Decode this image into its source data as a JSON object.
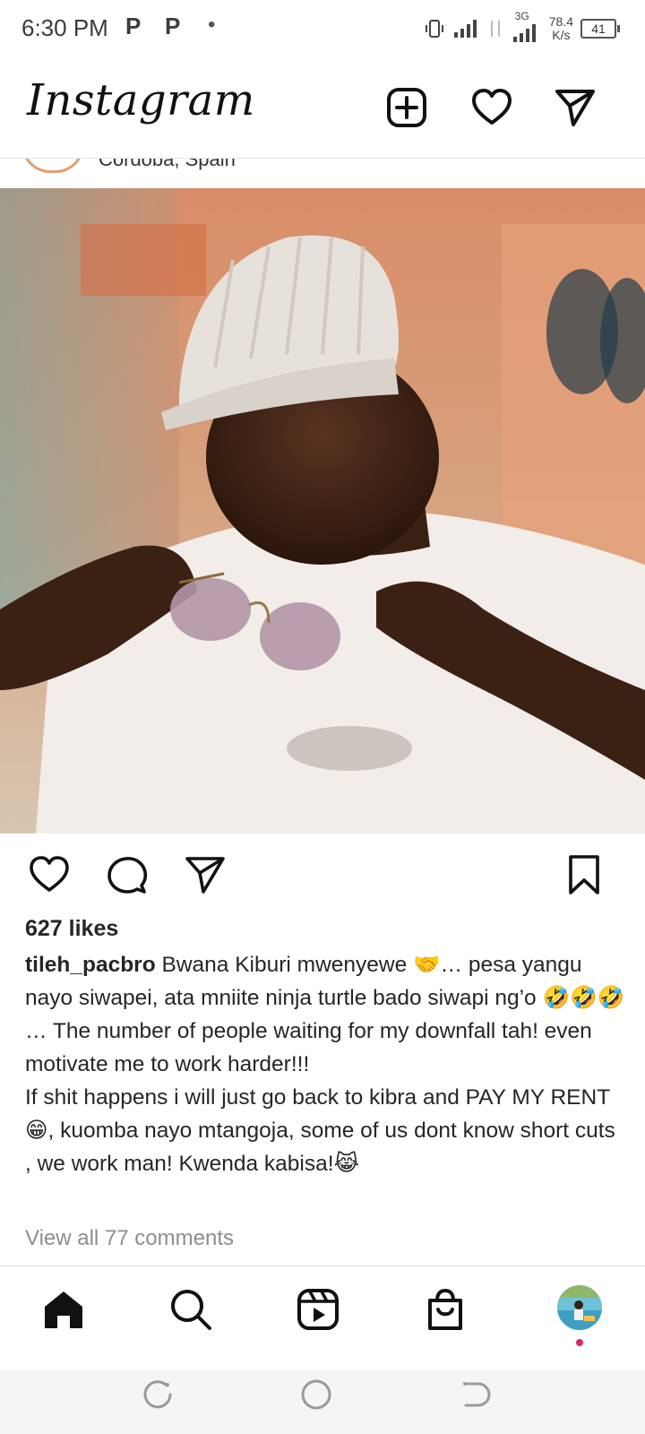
{
  "status_bar": {
    "time": "6:30 PM",
    "notif_icons": [
      "P",
      "P"
    ],
    "net_3g": "3G",
    "net_speed": "78.4",
    "net_unit": "K/s",
    "battery": "41"
  },
  "header": {
    "logo": "Instagram",
    "icons": [
      "new-post-icon",
      "heart-icon",
      "direct-message-icon"
    ]
  },
  "post": {
    "location_partial": "Cordoba, Spain",
    "likes": "627 likes",
    "username": "tileh_pacbro",
    "caption": " Bwana Kiburi mwenyewe 🤝… pesa yangu nayo siwapei, ata mniite ninja turtle bado siwapi ng’o 🤣🤣🤣 … The number of people waiting for my downfall tah! even motivate me to work harder!!!\nIf shit happens i will just go back to kibra and PAY MY RENT 😁, kuomba nayo mtangoja, some of us dont know short cuts , we work man! Kwenda kabisa!😹",
    "view_comments": "View all 77 comments"
  },
  "bottom_nav": {
    "items": [
      "home-icon",
      "search-icon",
      "reels-icon",
      "shop-icon",
      "profile-avatar"
    ],
    "notification_dot_color": "#e0245e"
  },
  "colors": {
    "text": "#262626",
    "muted": "#8e8e8e",
    "divider": "#dbdbdb"
  }
}
